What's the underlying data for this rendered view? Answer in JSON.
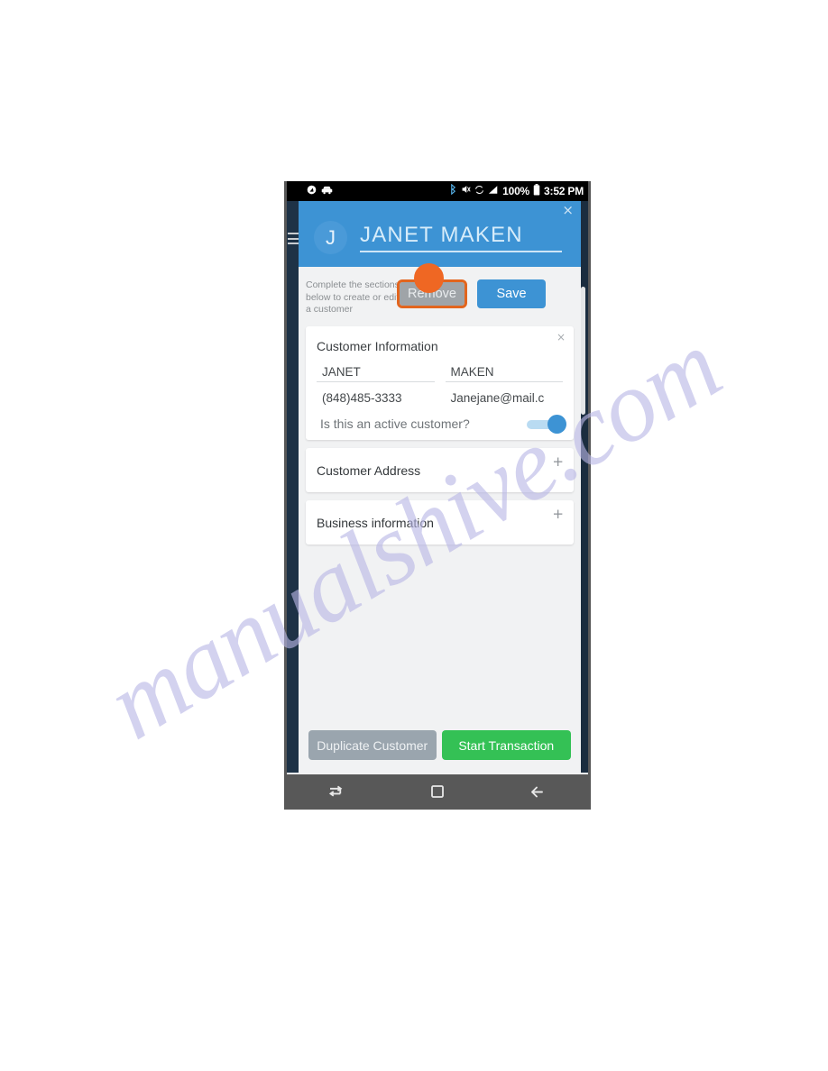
{
  "status_bar": {
    "left_icons": [
      "compass-icon",
      "car-icon"
    ],
    "right_icons": [
      "bluetooth-icon",
      "mute-icon",
      "sync-icon",
      "signal-icon"
    ],
    "battery_percent": "100%",
    "battery_icon": "battery-full-icon",
    "time": "3:52 PM"
  },
  "header": {
    "avatar_initial": "J",
    "customer_name": "JANET MAKEN",
    "close_label": "×",
    "background_color": "#3d93d4"
  },
  "actions": {
    "helper_text": "Complete the sections below to create or edit a customer",
    "remove_label": "Remove",
    "save_label": "Save",
    "highlight_color": "#e2651e"
  },
  "customer_information": {
    "title": "Customer Information",
    "close_label": "×",
    "first_name": "JANET",
    "last_name": "MAKEN",
    "phone": "(848)485-3333",
    "email": "Janejane@mail.c",
    "active_question": "Is this an active customer?",
    "active_toggle_state": "on"
  },
  "sections": [
    {
      "title": "Customer Address",
      "expand_label": "+"
    },
    {
      "title": "Business information",
      "expand_label": "+"
    }
  ],
  "bottom_actions": {
    "duplicate_label": "Duplicate Customer",
    "start_label": "Start Transaction",
    "start_color": "#34c155",
    "duplicate_color": "#9aa5ae"
  },
  "nav_bar": {
    "recent_icon": "recent-apps-icon",
    "home_icon": "home-icon",
    "back_icon": "back-arrow-icon"
  },
  "watermark": {
    "text": "manualshive.com"
  }
}
